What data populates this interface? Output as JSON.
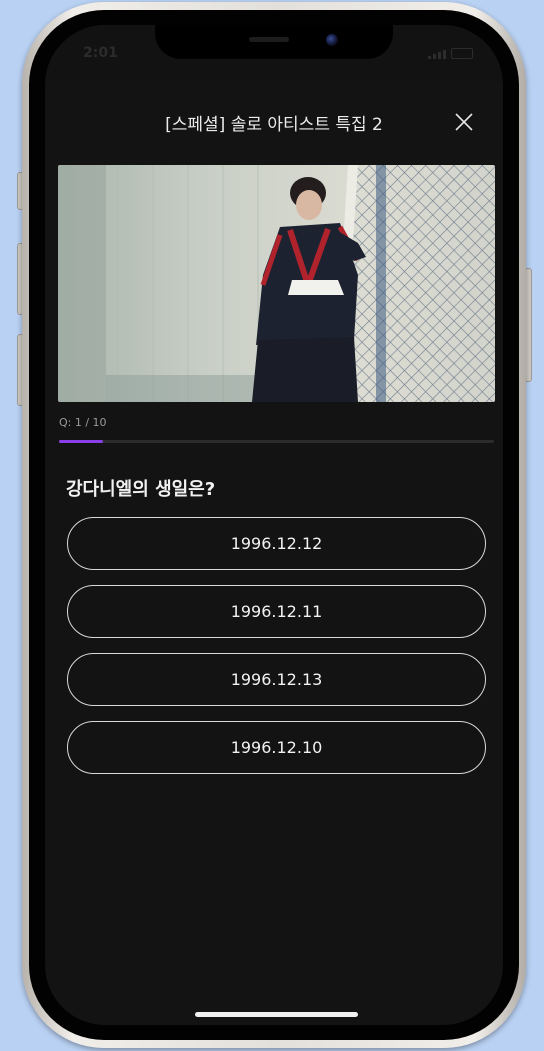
{
  "status_bar": {
    "time": "2:01"
  },
  "header": {
    "title": "[스페셜] 솔로 아티스트 특집 2",
    "close_icon": "close-icon"
  },
  "quiz": {
    "counter": "Q: 1 / 10",
    "progress": 0.1,
    "question": "강다니엘의 생일은?",
    "options": [
      "1996.12.12",
      "1996.12.11",
      "1996.12.13",
      "1996.12.10"
    ]
  },
  "colors": {
    "background": "#131313",
    "progress_accent": "#8a3ee8",
    "option_border": "#d9d9d9",
    "text": "#f2f2f2"
  }
}
